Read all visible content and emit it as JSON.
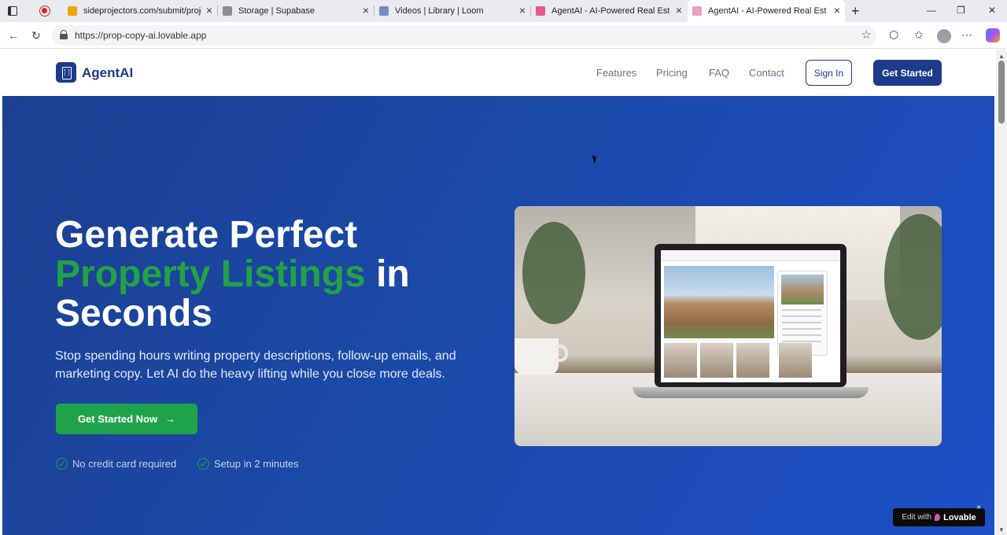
{
  "browser": {
    "tabs": [
      {
        "title": "sideprojectors.com/submit/project",
        "favicon_color": "#f2a40a",
        "active": false
      },
      {
        "title": "Storage | Supabase",
        "favicon_color": "#8a8f8c",
        "active": false
      },
      {
        "title": "Videos | Library | Loom",
        "favicon_color": "#7a89c9",
        "active": false
      },
      {
        "title": "AgentAI - AI-Powered Real Estate",
        "favicon_color": "#e45a8f",
        "active": false
      },
      {
        "title": "AgentAI - AI-Powered Real Estate",
        "favicon_color": "#e8a0c4",
        "active": true
      }
    ],
    "url": "https://prop-copy-ai.lovable.app"
  },
  "site": {
    "brand": "AgentAI",
    "nav": {
      "features": "Features",
      "pricing": "Pricing",
      "faq": "FAQ",
      "contact": "Contact",
      "sign_in": "Sign In",
      "get_started": "Get Started"
    },
    "hero": {
      "headline_line1": "Generate Perfect",
      "headline_highlight": "Property Listings",
      "headline_in": " in",
      "headline_line3": "Seconds",
      "subtext": "Stop spending hours writing property descriptions, follow-up emails, and marketing copy. Let AI do the heavy lifting while you close more deals.",
      "cta": "Get Started Now",
      "checks": [
        "No credit card required",
        "Setup in 2 minutes"
      ]
    },
    "badge": {
      "prefix": "Edit with",
      "brand": "Lovable"
    }
  },
  "colors": {
    "primary": "#1e3a8a",
    "accent_green": "#22a146",
    "hero_bg": "#1d4fc6"
  }
}
